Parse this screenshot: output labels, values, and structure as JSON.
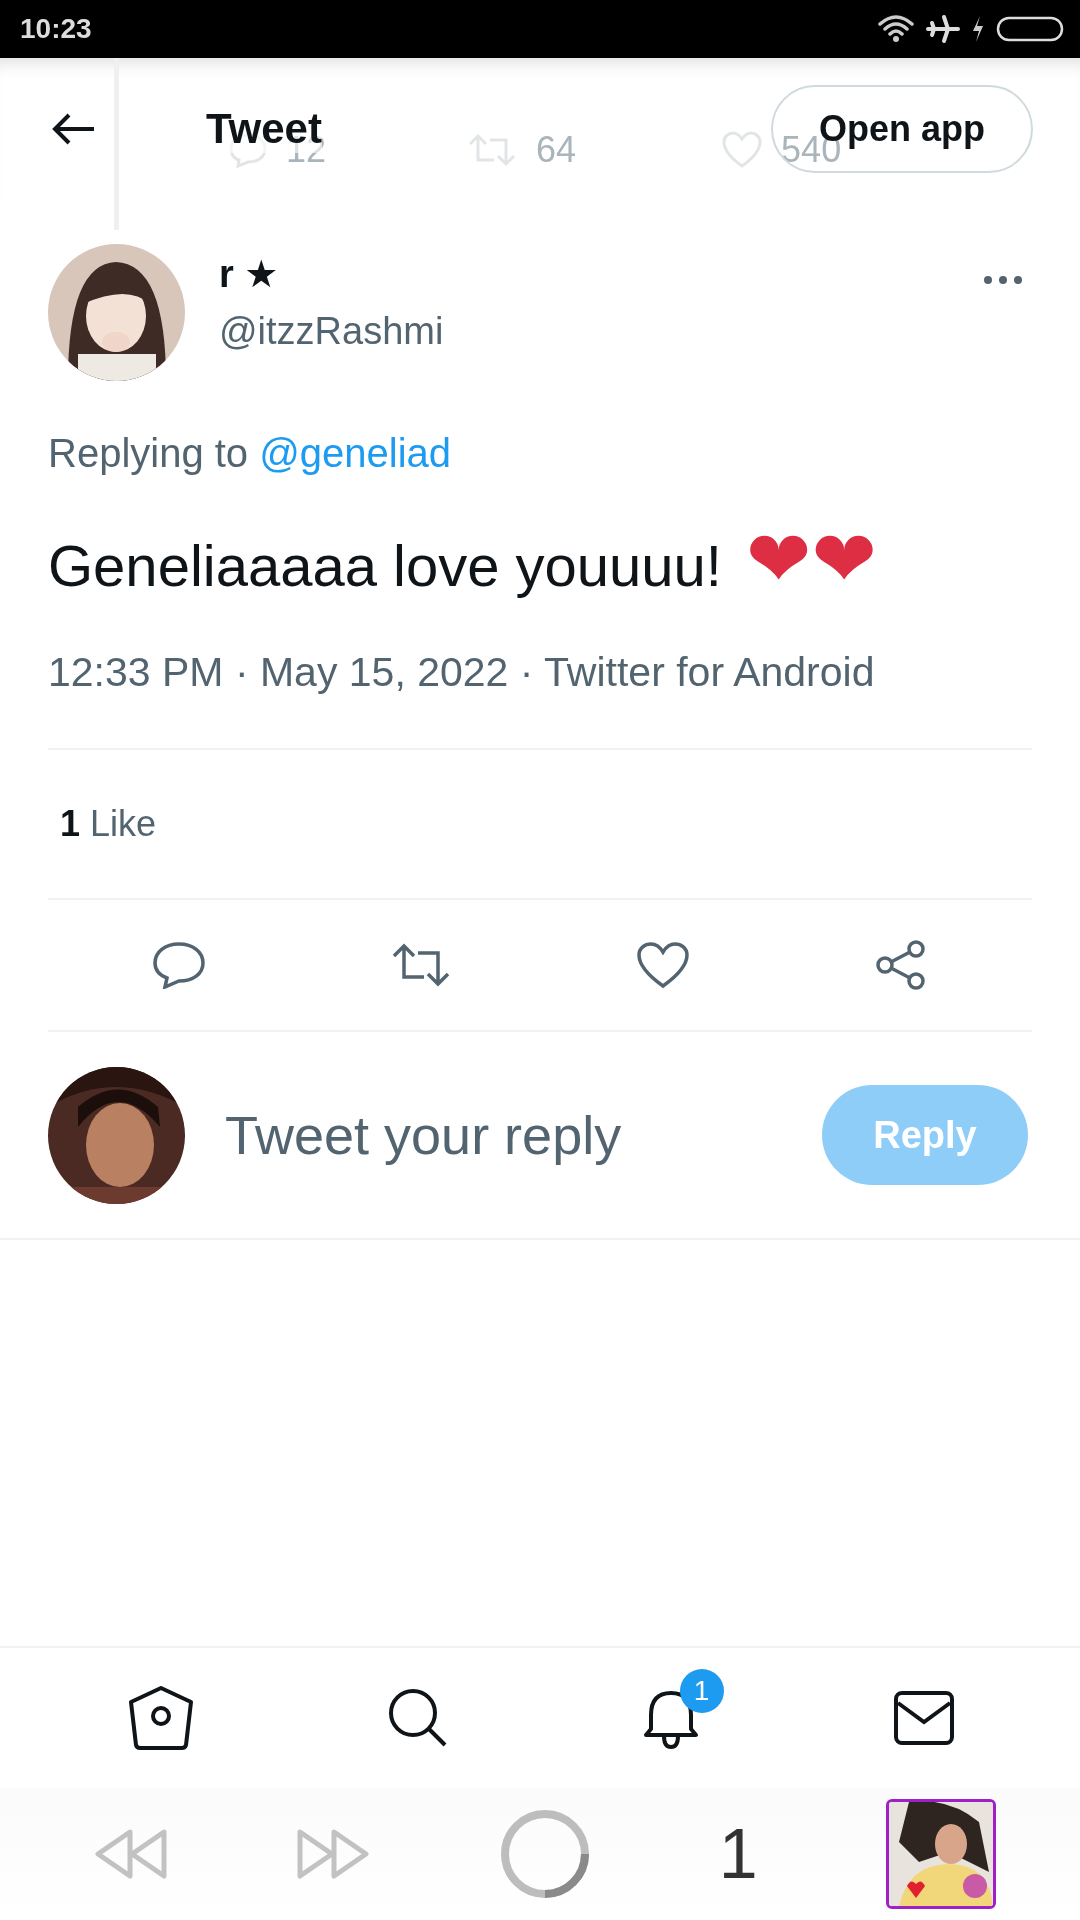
{
  "status_bar": {
    "time": "10:23"
  },
  "header": {
    "title": "Tweet",
    "open_app": "Open app",
    "behind_counts": [
      "12",
      "64",
      "540"
    ]
  },
  "tweet": {
    "name": "r ★",
    "handle": "@itzzRashmi",
    "replying_label": "Replying to",
    "replying_to": "@geneliad",
    "text": "Geneliaaaaa love youuuu!",
    "emoji": "❤❤",
    "meta": "12:33 PM · May 15, 2022 · Twitter for Android",
    "like_count": "1",
    "like_label": "Like"
  },
  "reply": {
    "placeholder": "Tweet your reply",
    "button": "Reply",
    "disabled": true
  },
  "bottom_nav": {
    "notification_badge": "1"
  },
  "browser_bar": {
    "tab_count": "1",
    "loading": true
  }
}
